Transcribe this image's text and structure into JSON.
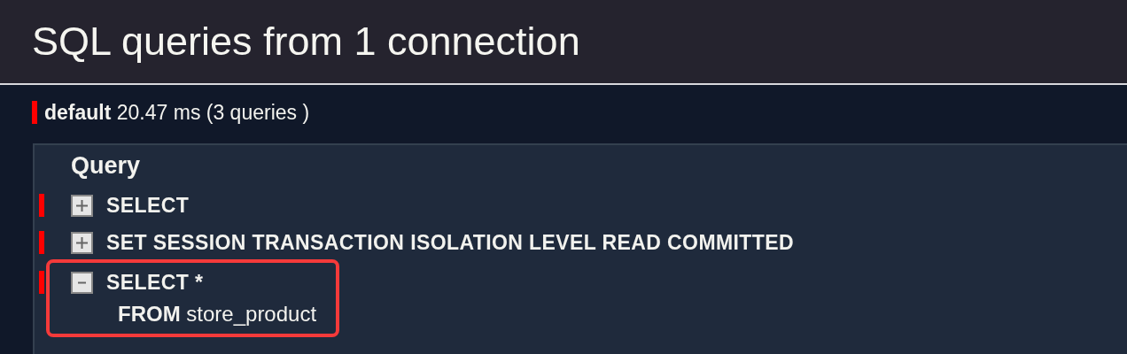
{
  "title": "SQL queries from 1 connection",
  "connection": {
    "name": "default",
    "summary": "20.47 ms (3 queries )"
  },
  "table": {
    "column": "Query",
    "queries": [
      {
        "summary": "SELECT",
        "expanded": false,
        "highlighted": false
      },
      {
        "summary": "SET SESSION TRANSACTION ISOLATION LEVEL READ COMMITTED",
        "expanded": false,
        "highlighted": false
      },
      {
        "summary": "SELECT *",
        "expanded": true,
        "highlighted": true,
        "detail_lines": [
          "**FROM** store_product"
        ]
      }
    ]
  }
}
